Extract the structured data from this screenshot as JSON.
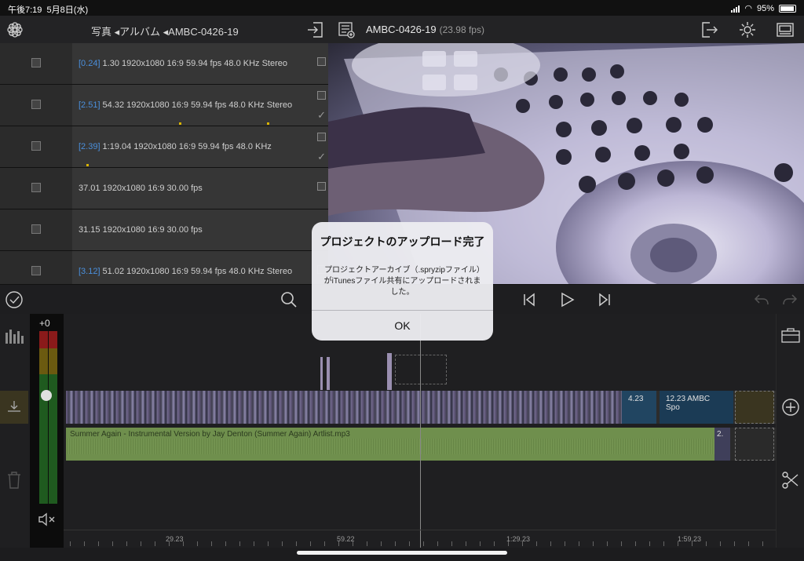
{
  "status_bar": {
    "time": "午後7:19",
    "date": "5月8日(水)",
    "battery": "95%"
  },
  "left_header": {
    "breadcrumb": "写真 ◂アルバム ◂AMBC-0426-19"
  },
  "clips": [
    {
      "index": "[0.24]",
      "details": "1.30  1920x1080  16:9  59.94 fps  48.0 KHz  Stereo",
      "checked": false
    },
    {
      "index": "[2.51]",
      "details": "54.32  1920x1080  16:9  59.94 fps  48.0 KHz  Stereo",
      "checked": true
    },
    {
      "index": "[2.39]",
      "details": "1:19.04  1920x1080  16:9  59.94 fps  48.0 KHz",
      "checked": true
    },
    {
      "index": "",
      "details": "37.01  1920x1080  16:9  30.00 fps",
      "checked": false
    },
    {
      "index": "",
      "details": "31.15  1920x1080  16:9  30.00 fps",
      "checked": false
    },
    {
      "index": "[3.12]",
      "details": "51.02  1920x1080  16:9  59.94 fps  48.0 KHz  Stereo",
      "checked": false
    }
  ],
  "project": {
    "name": "AMBC-0426-19",
    "fps": "(23.98 fps)"
  },
  "mixer": {
    "level_db": "+0"
  },
  "timeline": {
    "video_clip_a_label": "4.23",
    "video_clip_b_label": "12.23  AMBC Spo",
    "audio_clip_label": "Summer Again - Instrumental Version by Jay Denton (Summer Again) Artlist.mp3",
    "audio_tail_label": "2.",
    "ruler_labels": [
      "29.23",
      "59.22",
      "1:29.23",
      "1:59.23"
    ]
  },
  "dialog": {
    "title": "プロジェクトのアップロード完了",
    "message": "プロジェクトアーカイブ（.spryzipファイル）がiTunesファイル共有にアップロードされました。",
    "ok_label": "OK"
  },
  "icons": {
    "app": "flower-icon",
    "import": "import-icon",
    "project": "project-list-icon",
    "export": "export-icon",
    "settings": "gear-icon",
    "layout": "layout-icon",
    "check": "check-circle-icon",
    "search": "search-icon",
    "prev": "skip-back-icon",
    "play": "play-icon",
    "next": "skip-forward-icon",
    "undo": "undo-icon",
    "redo": "redo-icon",
    "toolbox": "toolbox-icon",
    "add": "add-circle-icon",
    "scissors": "scissors-icon",
    "trash": "trash-icon",
    "mute": "mute-icon"
  },
  "colors": {
    "accent_blue": "#4a8fdc",
    "audio_green": "#6f8f4d",
    "video_blue": "#1b3b55"
  }
}
